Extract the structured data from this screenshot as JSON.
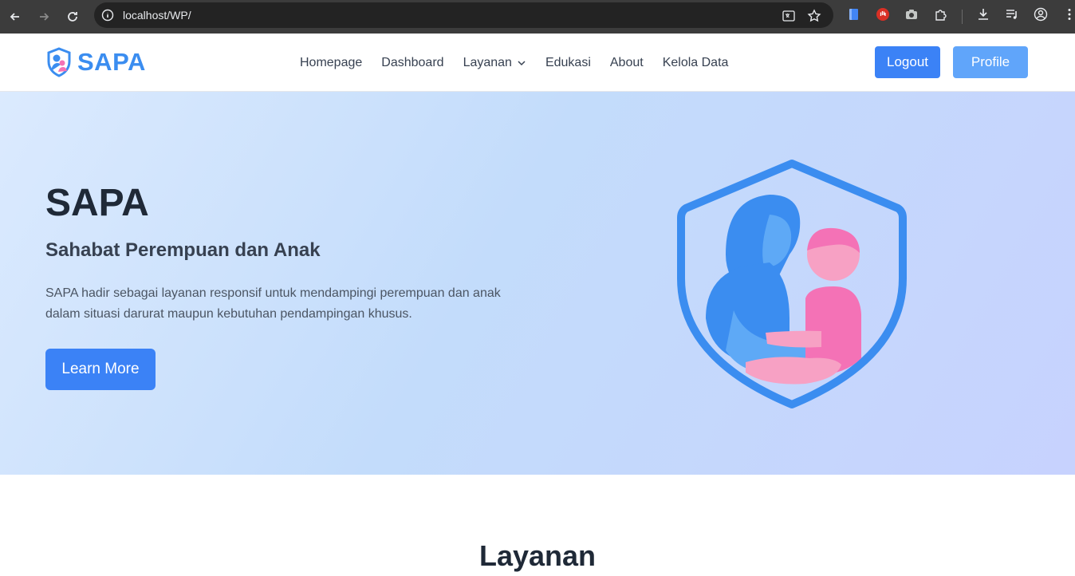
{
  "browser": {
    "url": "localhost/WP/"
  },
  "site": {
    "brand": "SAPA",
    "brand_color": "#3b8df0",
    "nav": [
      {
        "label": "Homepage"
      },
      {
        "label": "Dashboard"
      },
      {
        "label": "Layanan",
        "has_dropdown": true
      },
      {
        "label": "Edukasi"
      },
      {
        "label": "About"
      },
      {
        "label": "Kelola Data"
      }
    ],
    "logout_label": "Logout",
    "profile_label": "Profile"
  },
  "hero": {
    "title": "SAPA",
    "subtitle": "Sahabat Perempuan dan Anak",
    "description": "SAPA hadir sebagai layanan responsif untuk mendampingi perempuan dan anak dalam situasi darurat maupun kebutuhan pendampingan khusus.",
    "cta_label": "Learn More",
    "illustration": "mother-child-shield-icon"
  },
  "services": {
    "title": "Layanan"
  },
  "colors": {
    "primary": "#3b82f6",
    "primary_light": "#60a5fa",
    "pink": "#f472b6"
  }
}
